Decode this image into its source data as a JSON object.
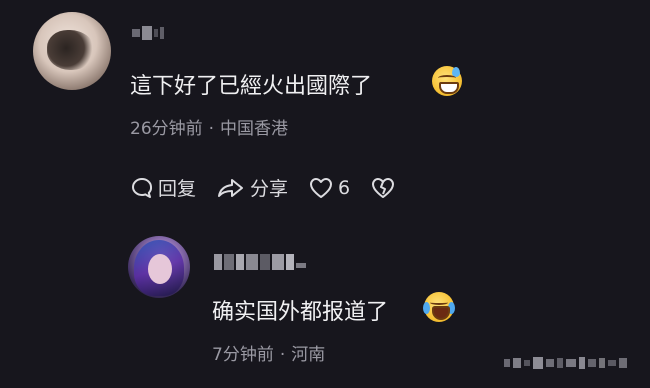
{
  "colors": {
    "background": "#17161d",
    "text_primary": "#f0f0f2",
    "text_secondary": "#9a99a3",
    "action_text": "#dcdce0"
  },
  "comments": [
    {
      "avatar_icon": "avatar-image",
      "text": "這下好了已經火出國際了",
      "emoji": "grinning-face-with-sweat-emoji",
      "time": "26分钟前",
      "location": "中国香港",
      "actions": {
        "reply_label": "回复",
        "share_label": "分享",
        "like_count": "6"
      }
    },
    {
      "avatar_icon": "anime-avatar-image",
      "text": "确实国外都报道了",
      "emoji": "loudly-crying-laughing-emoji",
      "time": "7分钟前",
      "location": "河南"
    }
  ],
  "separator": "·"
}
